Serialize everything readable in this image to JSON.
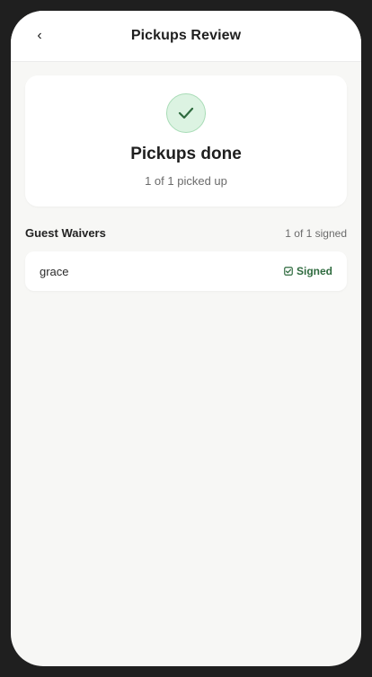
{
  "header": {
    "back_glyph": "‹",
    "title": "Pickups Review"
  },
  "summary": {
    "icon": "check-icon",
    "title": "Pickups done",
    "subtitle": "1 of 1 picked up"
  },
  "waivers": {
    "section_title": "Guest Waivers",
    "count_text": "1 of 1 signed",
    "items": [
      {
        "name": "grace",
        "status": "Signed",
        "status_icon": "checkbox-checked-icon"
      }
    ]
  },
  "colors": {
    "success": "#2f6b3f",
    "success_bg": "#dcf3e2",
    "page_bg": "#f7f7f5"
  }
}
